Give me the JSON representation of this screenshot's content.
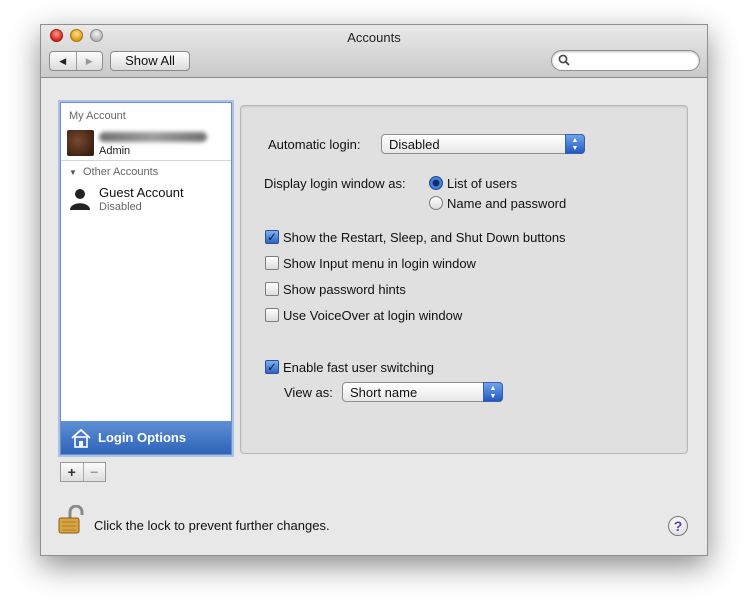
{
  "window": {
    "title": "Accounts"
  },
  "toolbar": {
    "back_glyph": "◀",
    "forward_glyph": "▶",
    "show_all_label": "Show All",
    "search_placeholder": "",
    "search_icon": "search-icon"
  },
  "sidebar": {
    "my_account_header": "My Account",
    "my_account": {
      "role": "Admin"
    },
    "other_accounts_header": "Other Accounts",
    "guest": {
      "name": "Guest Account",
      "status": "Disabled"
    },
    "login_options_label": "Login Options"
  },
  "panel": {
    "automatic_login_label": "Automatic login:",
    "automatic_login_value": "Disabled",
    "display_login_window_label": "Display login window as:",
    "radio_list_of_users": "List of users",
    "radio_name_and_password": "Name and password",
    "show_restart_label": "Show the Restart, Sleep, and Shut Down buttons",
    "show_restart_checked": true,
    "show_input_menu_label": "Show Input menu in login window",
    "show_input_menu_checked": false,
    "show_password_hints_label": "Show password hints",
    "show_password_hints_checked": false,
    "use_voiceover_label": "Use VoiceOver at login window",
    "use_voiceover_checked": false,
    "fast_user_switching_label": "Enable fast user switching",
    "fast_user_switching_checked": true,
    "view_as_label": "View as:",
    "view_as_value": "Short name"
  },
  "footer": {
    "lock_message": "Click the lock to prevent further changes.",
    "help_glyph": "?"
  },
  "colors": {
    "selection": "#2e63b8",
    "window_bg": "#e8e8e8",
    "panel_bg": "#e0e0e0"
  }
}
